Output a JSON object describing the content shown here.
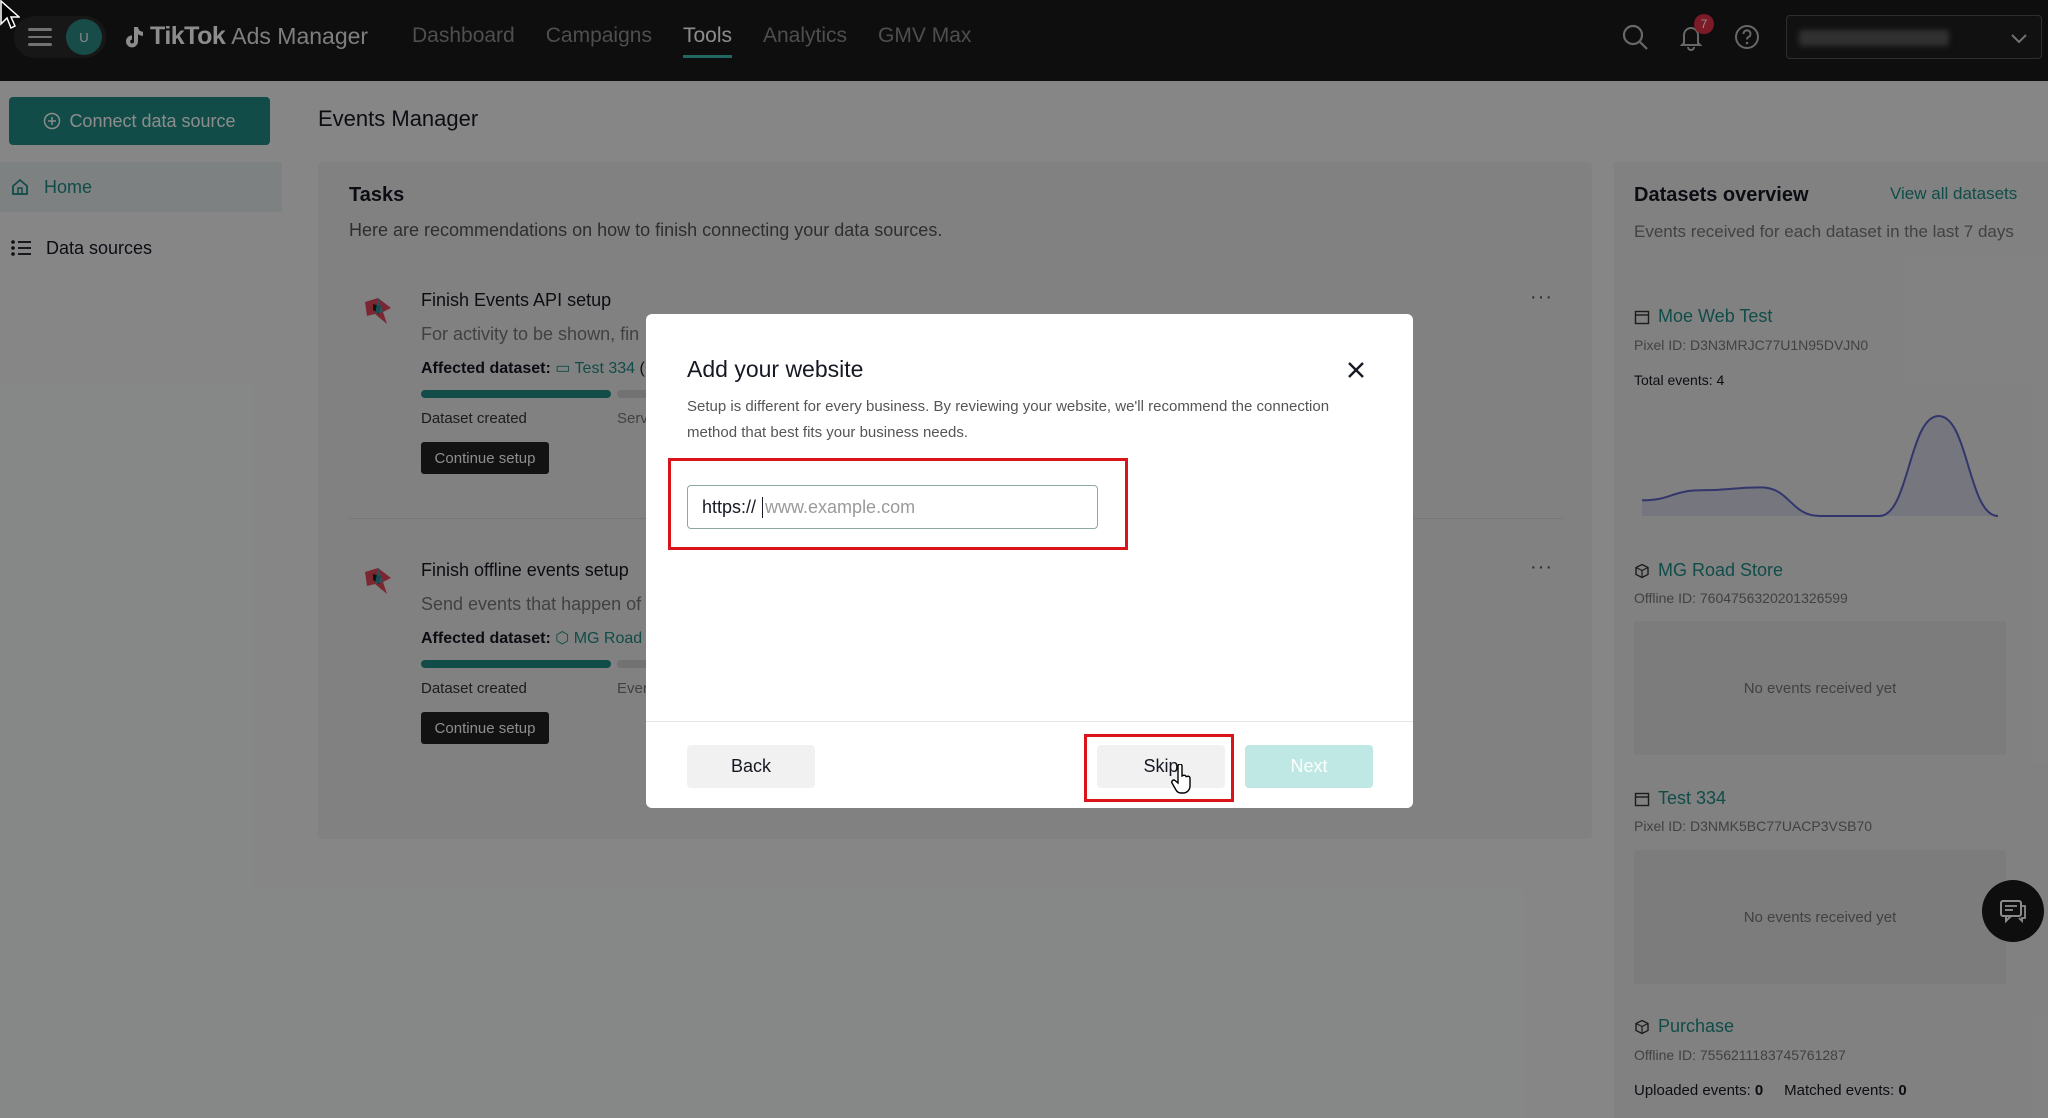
{
  "topbar": {
    "avatar_letter": "U",
    "brand": "TikTok",
    "brand_sub": "Ads Manager",
    "nav": [
      {
        "label": "Dashboard",
        "active": false
      },
      {
        "label": "Campaigns",
        "active": false
      },
      {
        "label": "Tools",
        "active": true
      },
      {
        "label": "Analytics",
        "active": false
      },
      {
        "label": "GMV Max",
        "active": false
      }
    ],
    "notification_count": "7"
  },
  "sidebar": {
    "connect_label": "Connect data source",
    "items": [
      {
        "label": "Home",
        "active": true
      },
      {
        "label": "Data sources",
        "active": false
      }
    ]
  },
  "main": {
    "page_title": "Events Manager",
    "tasks": {
      "title": "Tasks",
      "description": "Here are recommendations on how to finish connecting your data sources.",
      "items": [
        {
          "title": "Finish Events API setup",
          "description": "For activity to be shown, fin",
          "affected_label": "Affected dataset:",
          "affected_dataset": "Test 334",
          "affected_suffix": "(",
          "step_done": "Dataset created",
          "step_next": "Serv",
          "continue_label": "Continue setup"
        },
        {
          "title": "Finish offline events setup",
          "description": "Send events that happen of",
          "affected_label": "Affected dataset:",
          "affected_dataset": "MG Road S",
          "affected_suffix": "",
          "step_done": "Dataset created",
          "step_next": "Even",
          "continue_label": "Continue setup"
        }
      ]
    }
  },
  "datasets": {
    "title": "Datasets overview",
    "view_all": "View all datasets",
    "description": "Events received for each dataset in the last 7 days",
    "items": [
      {
        "name": "Moe Web Test",
        "id": "Pixel ID: D3N3MRJC77U1N95DVJN0",
        "total": "Total events: 4",
        "chart": [
          0.55,
          0.9,
          1.0,
          0.0,
          0.0,
          3.5,
          0.0
        ]
      },
      {
        "name": "MG Road Store",
        "id": "Offline ID: 7604756320201326599",
        "empty": "No events received yet"
      },
      {
        "name": "Test 334",
        "id": "Pixel ID: D3NMK5BC77UACP3VSB70",
        "empty": "No events received yet"
      },
      {
        "name": "Purchase",
        "id": "Offline ID: 7556211183745761287",
        "uploaded_label": "Uploaded events:",
        "uploaded_value": "0",
        "matched_label": "Matched events:",
        "matched_value": "0"
      }
    ]
  },
  "modal": {
    "title": "Add your website",
    "description": "Setup is different for every business. By reviewing your website, we'll recommend the connection method that best fits your business needs.",
    "url_prefix": "https://",
    "url_placeholder": "www.example.com",
    "url_value": "",
    "back_label": "Back",
    "skip_label": "Skip",
    "next_label": "Next"
  },
  "colors": {
    "accent": "#1f8b84",
    "topbar": "#1a1a1a",
    "highlight": "#d9151b",
    "next_disabled": "#bfe7e4"
  }
}
